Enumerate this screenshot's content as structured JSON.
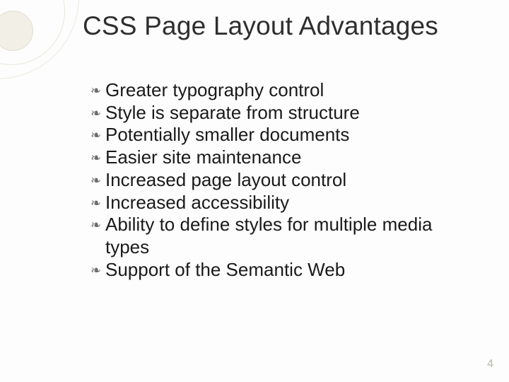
{
  "slide": {
    "title": "CSS Page Layout Advantages",
    "bullets": [
      "Greater typography control",
      "Style is separate from structure",
      "Potentially smaller documents",
      "Easier site maintenance",
      "Increased page layout control",
      "Increased accessibility",
      "Ability to define styles for multiple media types",
      "Support of the Semantic Web"
    ],
    "page_number": "4"
  }
}
